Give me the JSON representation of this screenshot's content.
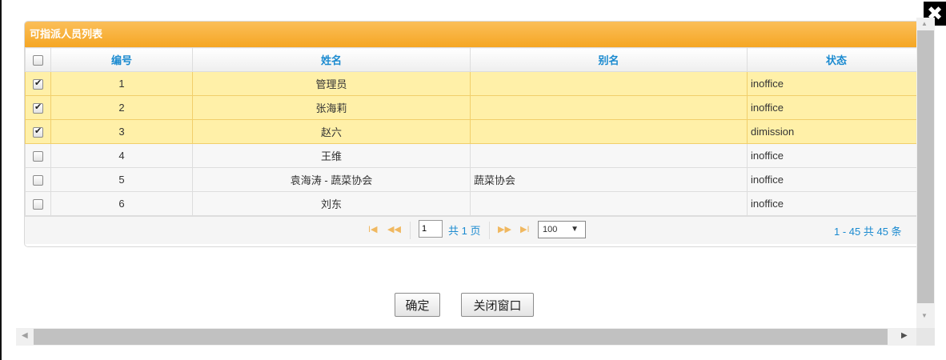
{
  "dialog": {
    "close_icon": "close-icon",
    "close_glyph": "✖"
  },
  "panel": {
    "title": "可指派人员列表",
    "columns": [
      "编号",
      "姓名",
      "别名",
      "状态"
    ],
    "rows": [
      {
        "checked": true,
        "id": "1",
        "name": "管理员",
        "alias": "",
        "status": "inoffice"
      },
      {
        "checked": true,
        "id": "2",
        "name": "张海莉",
        "alias": "",
        "status": "inoffice"
      },
      {
        "checked": true,
        "id": "3",
        "name": "赵六",
        "alias": "",
        "status": "dimission"
      },
      {
        "checked": false,
        "id": "4",
        "name": "王维",
        "alias": "",
        "status": "inoffice"
      },
      {
        "checked": false,
        "id": "5",
        "name": "袁海涛 - 蔬菜协会",
        "alias": "蔬菜协会",
        "status": "inoffice"
      },
      {
        "checked": false,
        "id": "6",
        "name": "刘东",
        "alias": "",
        "status": "inoffice"
      }
    ]
  },
  "pager": {
    "page_value": "1",
    "total_pages": "共 1 页",
    "page_size": "100",
    "info": "1 - 45   共 45 条"
  },
  "buttons": {
    "ok": "确定",
    "close": "关闭窗口"
  },
  "colors": {
    "header": "#f5a623",
    "selected_row": "#fff0a8",
    "link": "#1a8ad0"
  }
}
